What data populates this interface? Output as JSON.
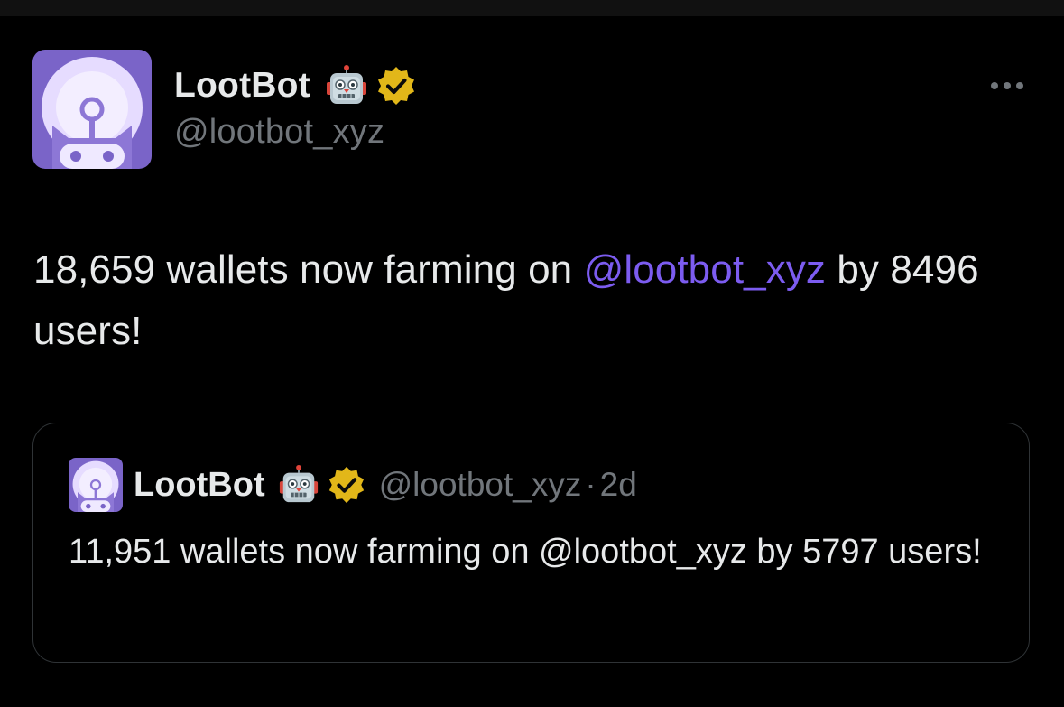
{
  "tweet": {
    "display_name": "LootBot",
    "name_emoji_icon": "robot-face-icon",
    "verified_icon": "verified-badge-icon",
    "handle": "@lootbot_xyz",
    "more_icon": "more-options-icon",
    "text_before": "18,659 wallets now farming on ",
    "mention": "@lootbot_xyz",
    "text_after": " by 8496 users!"
  },
  "quoted_tweet": {
    "display_name": "LootBot",
    "handle": "@lootbot_xyz",
    "separator": "·",
    "time": "2d",
    "text": "11,951 wallets now farming on @lootbot_xyz by 5797 users!"
  },
  "colors": {
    "background": "#000000",
    "text": "#e7e9ea",
    "secondary_text": "#71767b",
    "mention": "#7c5cf0",
    "avatar_purple": "#7a64c8",
    "verified_gold": "#e2b719",
    "card_border": "#2f3336"
  }
}
